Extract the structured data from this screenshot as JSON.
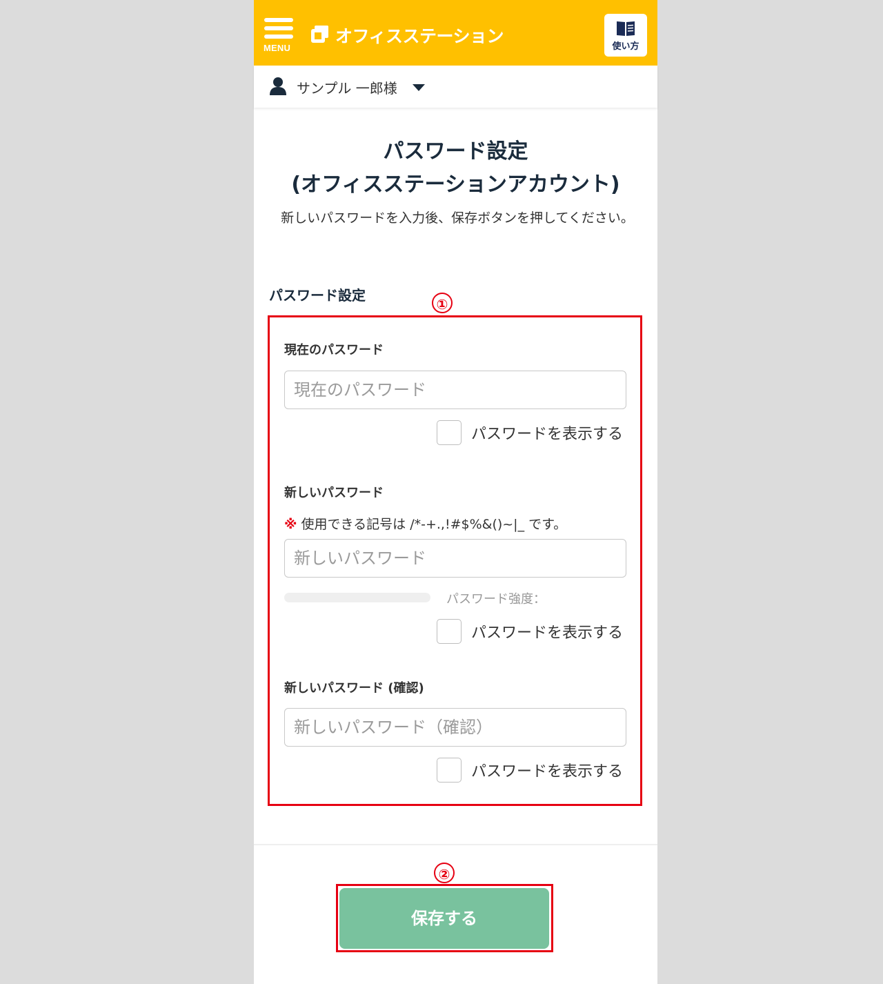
{
  "header": {
    "menu_label": "MENU",
    "brand": "オフィスステーション",
    "howto_label": "使い方"
  },
  "user": {
    "name": "サンプル 一郎様"
  },
  "page": {
    "title_line1": "パスワード設定",
    "title_line2": "(オフィスステーションアカウント)",
    "description": "新しいパスワードを入力後、保存ボタンを押してください。",
    "section_label": "パスワード設定"
  },
  "annotations": [
    "①",
    "②"
  ],
  "form": {
    "current": {
      "label": "現在のパスワード",
      "placeholder": "現在のパスワード",
      "show_label": "パスワードを表示する"
    },
    "new": {
      "label": "新しいパスワード",
      "note_mark": "※",
      "note_text": "使用できる記号は /*-+.,!#$%&()~|_ です。",
      "placeholder": "新しいパスワード",
      "strength_label": "パスワード強度：",
      "show_label": "パスワードを表示する"
    },
    "confirm": {
      "label": "新しいパスワード (確認)",
      "placeholder": "新しいパスワード（確認）",
      "show_label": "パスワードを表示する"
    }
  },
  "save_label": "保存する",
  "colors": {
    "header": "#ffc000",
    "accent_red": "#e60012",
    "save_button": "#79c29e"
  }
}
